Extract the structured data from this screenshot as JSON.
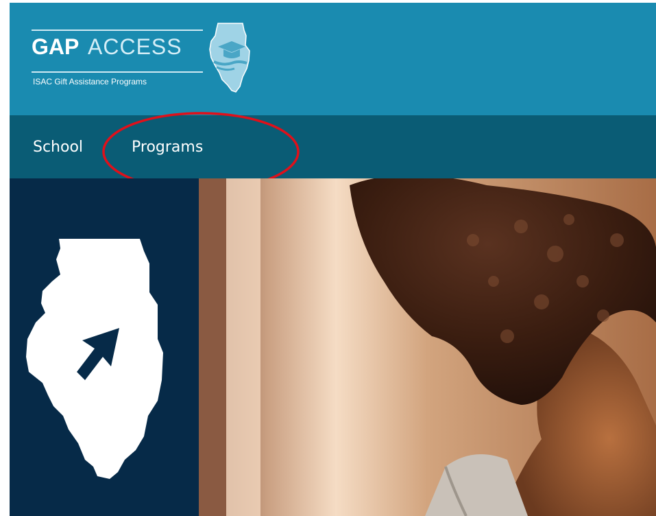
{
  "logo": {
    "gap": "GAP",
    "access": "ACCESS",
    "subtitle": "ISAC Gift Assistance Programs"
  },
  "nav": {
    "items": [
      {
        "label": "School"
      },
      {
        "label": "Programs"
      }
    ]
  },
  "colors": {
    "header_bg": "#1a8bb0",
    "nav_bg": "#0a5c75",
    "sidebar_bg": "#062a48",
    "annotation": "#e0101a"
  },
  "icons": {
    "logo_mark": "illinois-graduation-cap-icon",
    "sidebar_graphic": "illinois-cursor-icon"
  }
}
